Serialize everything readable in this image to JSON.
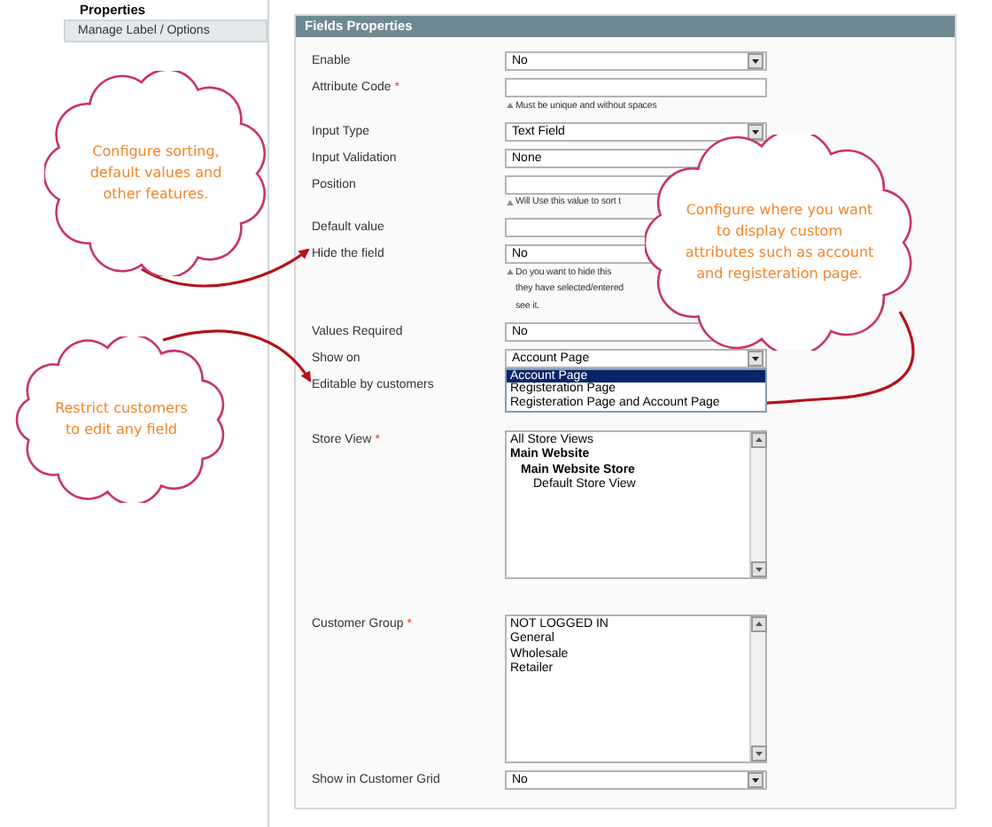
{
  "sidebar": {
    "heading": "Properties",
    "tabs": [
      {
        "label": "Manage Label / Options",
        "selected": true
      }
    ]
  },
  "panel": {
    "title": "Fields Properties",
    "rows": [
      {
        "kind": "select",
        "label": "Enable",
        "value": "No"
      },
      {
        "kind": "text",
        "label": "Attribute Code",
        "required_mark": "*",
        "hints": [
          "Must be unique and without spaces"
        ]
      },
      {
        "kind": "select",
        "label": "Input Type",
        "value": "Text Field"
      },
      {
        "kind": "select",
        "label": "Input Validation",
        "value": "None"
      },
      {
        "kind": "text",
        "label": "Position",
        "hints": [
          "Will Use this value to sort t"
        ]
      },
      {
        "kind": "text",
        "label": "Default value"
      },
      {
        "kind": "select",
        "label": "Hide the field",
        "value": "No",
        "hints": [
          "Do you want to hide this",
          "they have selected/entered",
          "see it."
        ]
      },
      {
        "kind": "select",
        "label": "Values Required",
        "value": "No"
      },
      {
        "kind": "dropdown",
        "label": "Show on",
        "value": "Account Page",
        "options": [
          {
            "label": "Account Page",
            "selected": true
          },
          {
            "label": "Registeration Page",
            "selected": false
          },
          {
            "label": "Registeration Page and Account Page",
            "selected": false
          }
        ]
      },
      {
        "kind": "label",
        "label": "Editable by customers"
      },
      {
        "kind": "listbox",
        "label": "Store View",
        "required_mark": "*",
        "items": [
          {
            "label": "All Store Views",
            "bold": false
          },
          {
            "label": "Main Website",
            "bold": true,
            "children": [
              {
                "label": "Main Website Store",
                "bold": true,
                "children": [
                  {
                    "label": "Default Store View",
                    "bold": false
                  }
                ]
              }
            ]
          }
        ]
      },
      {
        "kind": "listbox",
        "label": "Customer Group",
        "required_mark": "*",
        "items": [
          {
            "label": "NOT LOGGED IN",
            "bold": false
          },
          {
            "label": "General",
            "bold": false
          },
          {
            "label": "Wholesale",
            "bold": false
          },
          {
            "label": "Retailer",
            "bold": false
          }
        ]
      },
      {
        "kind": "select",
        "label": "Show in Customer Grid",
        "value": "No"
      }
    ]
  },
  "callouts": [
    {
      "text": "Configure sorting, default values and other features."
    },
    {
      "text": "Restrict customers to edit any field"
    },
    {
      "text": "Configure where you want to display custom attributes such as account and registeration page."
    }
  ]
}
